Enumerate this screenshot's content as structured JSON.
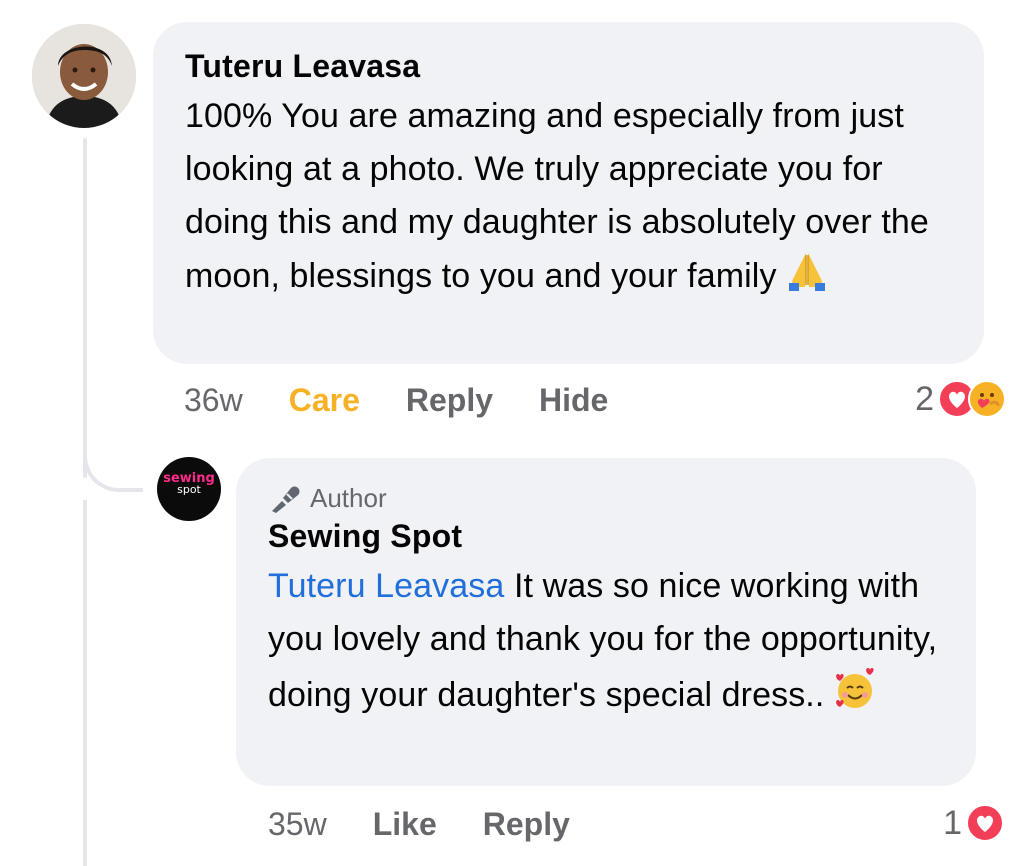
{
  "comment": {
    "author": "Tuteru Leavasa",
    "text": "100% You are amazing and especially from just looking at a photo. We truly appreciate you for doing this and my daughter is absolutely over the moon, blessings to you and your family",
    "emoji": "folded-hands",
    "time": "36w",
    "reaction_label": "Care",
    "reply_label": "Reply",
    "hide_label": "Hide",
    "reaction_count": "2",
    "reaction_icons": [
      "love-icon",
      "care-icon"
    ],
    "colors": {
      "care": "#f7b125"
    }
  },
  "reply": {
    "badge": "Author",
    "author": "Sewing Spot",
    "logo_top": "sewing",
    "logo_bottom": "spot",
    "mention": "Tuteru Leavasa",
    "text": " It was so nice working with you lovely and thank you for the opportunity, doing your daughter's special dress..",
    "emoji": "smiling-face-with-hearts",
    "time": "35w",
    "like_label": "Like",
    "reply_label": "Reply",
    "reaction_count": "1",
    "reaction_icons": [
      "love-icon"
    ],
    "colors": {
      "mention": "#216fdb",
      "logo_accent": "#ff2a8a"
    }
  }
}
